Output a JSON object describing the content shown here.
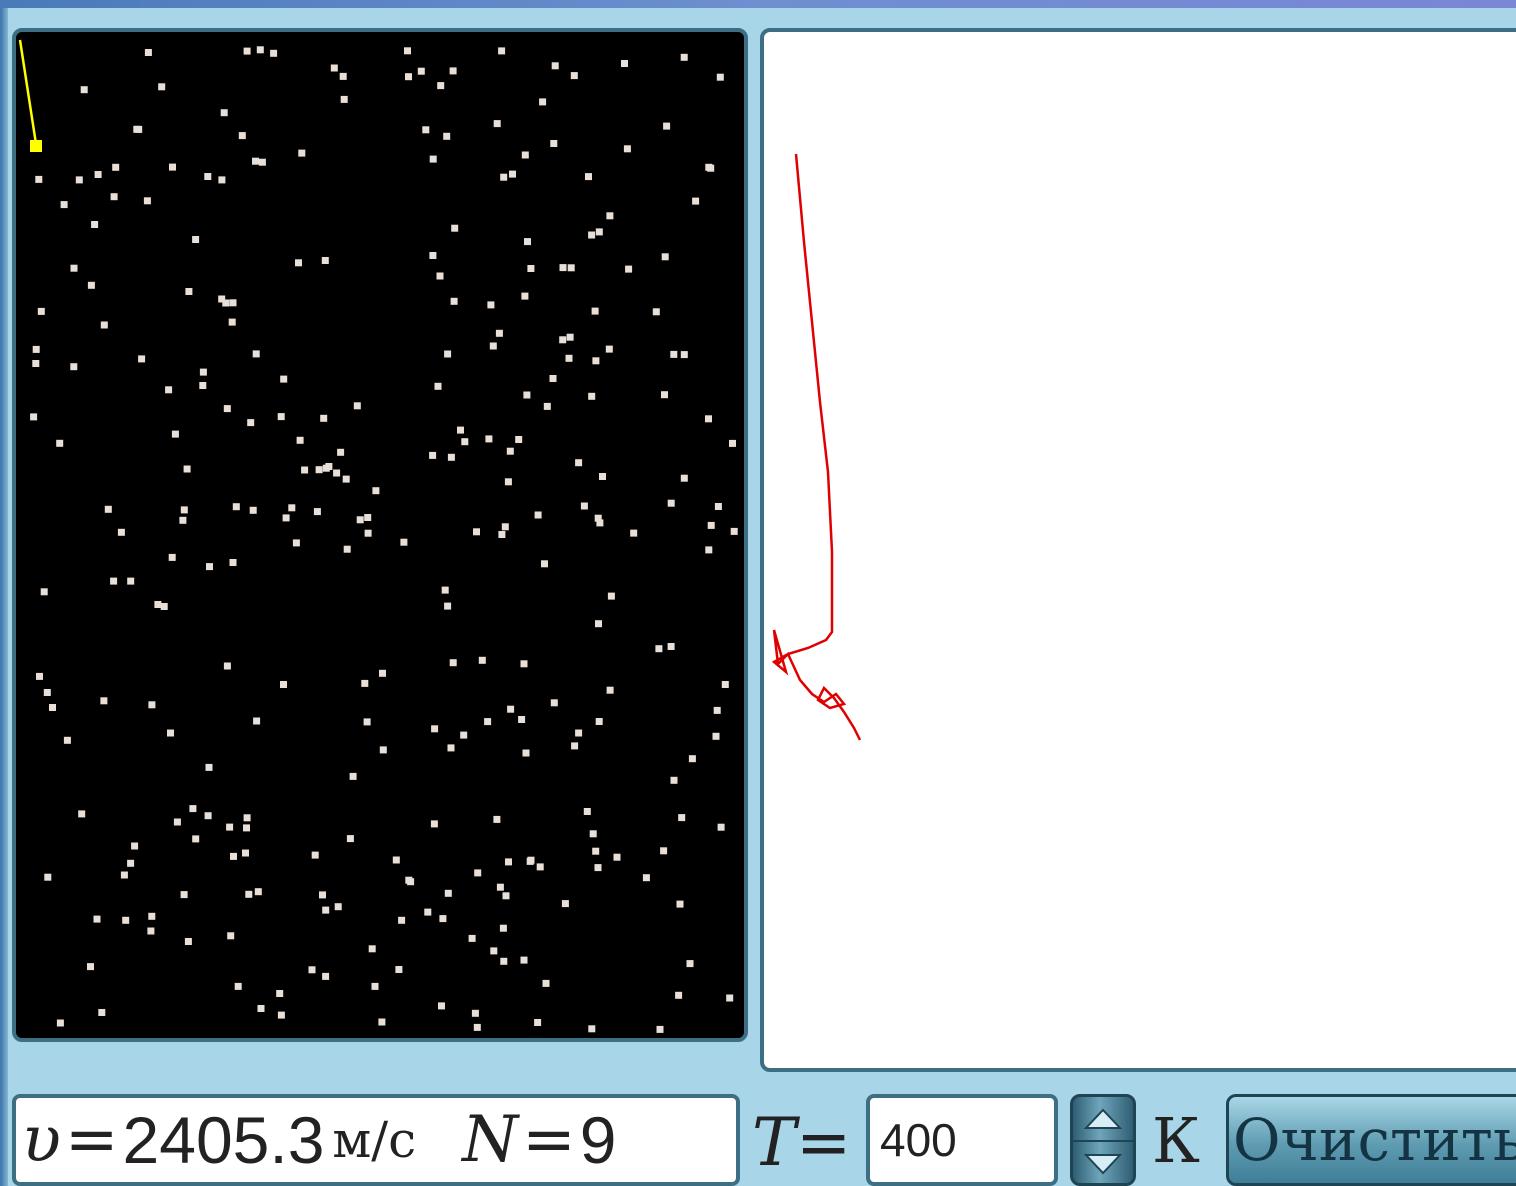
{
  "readout": {
    "v_symbol": "υ",
    "v_equals": "=",
    "v_value": "2405.3",
    "v_unit": "м/с",
    "n_symbol": "N",
    "n_equals": "=",
    "n_value": "9"
  },
  "temperature": {
    "symbol": "T",
    "equals": "=",
    "value": "400",
    "unit": "К"
  },
  "buttons": {
    "clear_label": "Очистить"
  },
  "icons": {
    "spinner_up": "triangle-up-icon",
    "spinner_down": "triangle-down-icon"
  },
  "colors": {
    "sim_background": "#000000",
    "gas_molecule": "#e8e0d8",
    "tracked_molecule": "#ffff00",
    "trajectory": "#e00000",
    "panel_border": "#3c6f84",
    "panel_background": "#a8d6e8"
  }
}
